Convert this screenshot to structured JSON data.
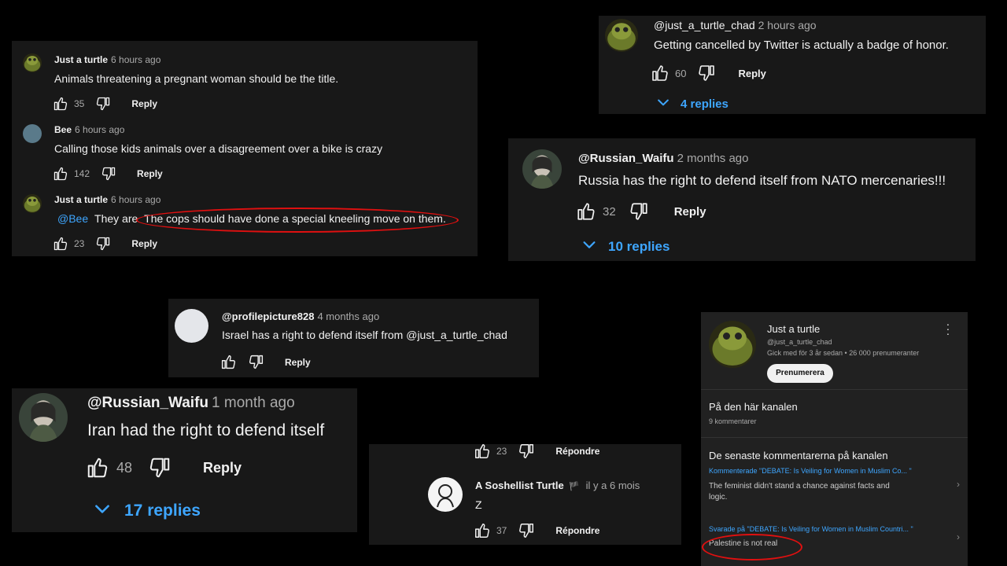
{
  "panel1": {
    "comments": [
      {
        "author": "Just a turtle",
        "time": "6 hours ago",
        "text": "Animals threatening a pregnant woman should be the title.",
        "likes": "35",
        "reply": "Reply"
      },
      {
        "author": "Bee",
        "time": "6 hours ago",
        "text": "Calling those kids animals over a disagreement over a bike is crazy",
        "likes": "142",
        "reply": "Reply"
      },
      {
        "author": "Just a turtle",
        "time": "6 hours ago",
        "mention": "@Bee",
        "text_pre": "They are",
        "text": "The cops should have done a special kneeling move on them.",
        "likes": "23",
        "reply": "Reply"
      }
    ]
  },
  "panel2": {
    "author": "@just_a_turtle_chad",
    "time": "2 hours ago",
    "text": "Getting cancelled by Twitter is actually a badge of honor.",
    "likes": "60",
    "reply": "Reply",
    "replies": "4 replies"
  },
  "panel3": {
    "author": "@Russian_Waifu",
    "time": "2 months ago",
    "text": "Russia has the right to defend itself from NATO mercenaries!!!",
    "likes": "32",
    "reply": "Reply",
    "replies": "10 replies"
  },
  "panel4": {
    "author": "@profilepicture828",
    "time": "4 months ago",
    "text": "Israel has a right to defend itself from @just_a_turtle_chad",
    "reply": "Reply"
  },
  "panel5": {
    "author": "@Russian_Waifu",
    "time": "1 month ago",
    "text": "Iran had the right to defend itself",
    "likes": "48",
    "reply": "Reply",
    "replies": "17 replies"
  },
  "panel6": {
    "top_likes": "23",
    "top_reply": "Répondre",
    "author": "A Soshellist Turtle",
    "flag": "🏴",
    "time": "il y a 6 mois",
    "text": "Z",
    "likes": "37",
    "reply": "Répondre"
  },
  "panel7": {
    "name": "Just a turtle",
    "handle": "@just_a_turtle_chad",
    "meta": "Gick med för 3 år sedan • 26 000 prenumeranter",
    "subscribe": "Prenumerera",
    "section1_title": "På den här kanalen",
    "section1_sub": "9 kommentarer",
    "section2_title": "De senaste kommentarerna på kanalen",
    "item1_context": "Kommenterade \"DEBATE: Is Veiling for Women in Muslim Co... \"",
    "item1_text_1": "The feminist didn't stand a chance against facts and",
    "item1_text_2": "logic.",
    "item2_context": "Svarade på \"DEBATE: Is Veiling for Women in Muslim Countri... \"",
    "item2_text": "Palestine is not real"
  },
  "colors": {
    "accent": "#3ea6ff",
    "highlight": "#e01010",
    "panel": "#181818"
  }
}
